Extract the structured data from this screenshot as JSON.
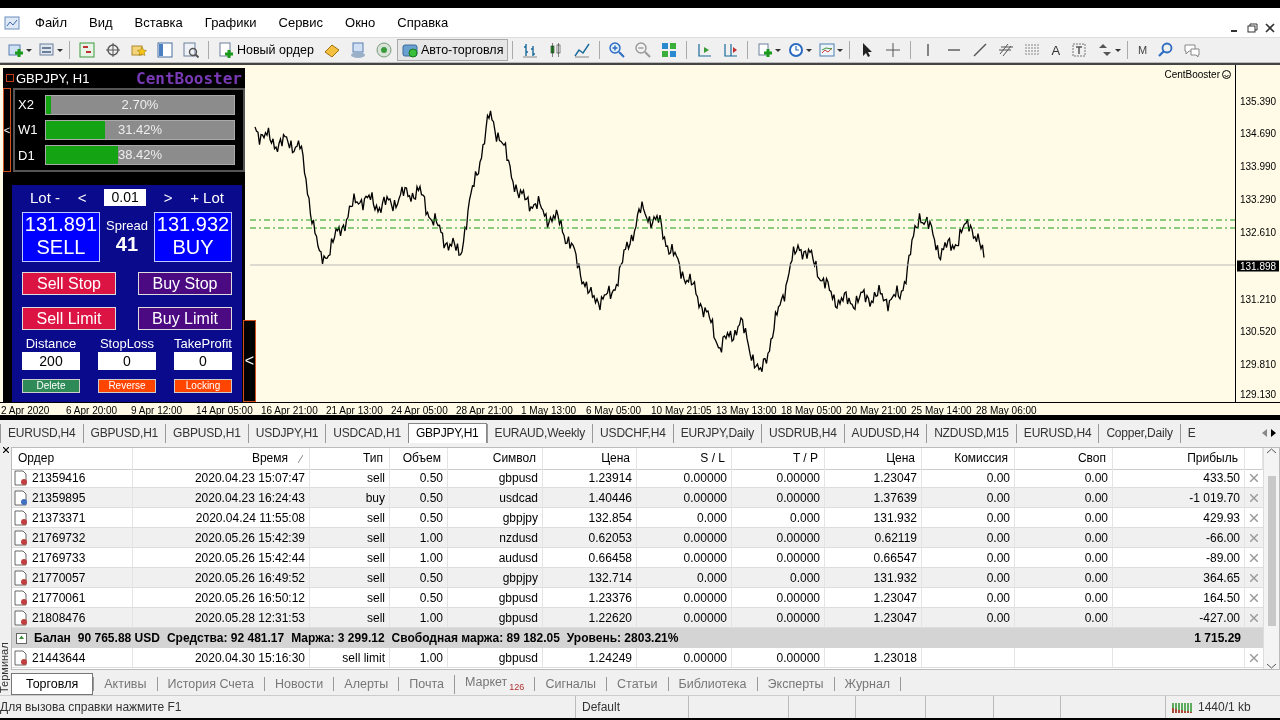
{
  "menu": [
    "Файл",
    "Вид",
    "Вставка",
    "Графики",
    "Сервис",
    "Окно",
    "Справка"
  ],
  "toolbar": {
    "new_order": "Новый ордер",
    "auto_trading": "Авто-торговля",
    "text_tool": "A",
    "m_button": "M"
  },
  "chart": {
    "indicator_label": "CentBooster",
    "price_labels": [
      "135.390",
      "134.690",
      "133.990",
      "133.290",
      "132.610",
      "131.210",
      "130.520",
      "129.810",
      "129.130"
    ],
    "current_price": "131.898",
    "time_labels": [
      "2 Apr 2020",
      "6 Apr 20:00",
      "9 Apr 12:00",
      "14 Apr 05:00",
      "16 Apr 21:00",
      "21 Apr 13:00",
      "24 Apr 05:00",
      "28 Apr 21:00",
      "1 May 13:00",
      "6 May 05:00",
      "10 May 21:05",
      "13 May 13:00",
      "18 May 05:00",
      "20 May 21:00",
      "25 May 14:00",
      "28 May 06:00"
    ]
  },
  "panel": {
    "title": "GBPJPY, H1",
    "brand": "CentBooster",
    "side_tab": "<",
    "collapse_tab": "<",
    "bars": [
      {
        "label": "X2",
        "level": 0.027,
        "reading": "2.70%"
      },
      {
        "label": "W1",
        "level": 0.3142,
        "reading": "31.42%"
      },
      {
        "label": "D1",
        "level": 0.3842,
        "reading": "38.42%"
      }
    ],
    "lot_minus": "Lot -",
    "lot_dec": "<",
    "lot": "0.01",
    "lot_inc": ">",
    "lot_plus": "+ Lot",
    "sell_price": "131.891",
    "sell": "SELL",
    "spread_label": "Spread",
    "spread": "41",
    "buy_price": "131.932",
    "buy": "BUY",
    "orders": [
      {
        "label": "Sell Stop",
        "kind": "sell"
      },
      {
        "label": "Buy Stop",
        "kind": "buy"
      },
      {
        "label": "Sell Limit",
        "kind": "sell"
      },
      {
        "label": "Buy Limit",
        "kind": "buy"
      }
    ],
    "fields": [
      {
        "label": "Distance",
        "value": "200"
      },
      {
        "label": "StopLoss",
        "value": "0"
      },
      {
        "label": "TakeProfit",
        "value": "0"
      }
    ],
    "actions": [
      {
        "label": "Delete",
        "kind": "delete"
      },
      {
        "label": "Reverse",
        "kind": "reverse"
      },
      {
        "label": "Locking",
        "kind": "locking"
      }
    ]
  },
  "symbol_tabs": [
    {
      "label": "EURUSD,H4",
      "selected": false
    },
    {
      "label": "GBPUSD,H1",
      "selected": false
    },
    {
      "label": "GBPUSD,H1",
      "selected": false
    },
    {
      "label": "USDJPY,H1",
      "selected": false
    },
    {
      "label": "USDCAD,H1",
      "selected": false
    },
    {
      "label": "GBPJPY,H1",
      "selected": true
    },
    {
      "label": "EURAUD,Weekly",
      "selected": false
    },
    {
      "label": "USDCHF,H4",
      "selected": false
    },
    {
      "label": "EURJPY,Daily",
      "selected": false
    },
    {
      "label": "USDRUB,H4",
      "selected": false
    },
    {
      "label": "AUDUSD,H4",
      "selected": false
    },
    {
      "label": "NZDUSD,M15",
      "selected": false
    },
    {
      "label": "EURUSD,H4",
      "selected": false
    },
    {
      "label": "Copper,Daily",
      "selected": false
    },
    {
      "label": "E",
      "selected": false
    }
  ],
  "terminal": {
    "side_label": "Терминал",
    "columns": [
      "Ордер",
      "Время",
      "Тип",
      "Объем",
      "Символ",
      "Цена",
      "S / L",
      "T / P",
      "Цена",
      "Комиссия",
      "Своп",
      "Прибыль"
    ],
    "rows": [
      {
        "kind": "sell",
        "cells": [
          "21359416",
          "2020.04.23 15:07:47",
          "sell",
          "0.50",
          "gbpusd",
          "1.23914",
          "0.00000",
          "0.00000",
          "1.23047",
          "0.00",
          "0.00",
          "433.50"
        ]
      },
      {
        "kind": "buy",
        "cells": [
          "21359895",
          "2020.04.23 16:24:43",
          "buy",
          "0.50",
          "usdcad",
          "1.40446",
          "0.00000",
          "0.00000",
          "1.37639",
          "0.00",
          "0.00",
          "-1 019.70"
        ]
      },
      {
        "kind": "sell",
        "cells": [
          "21373371",
          "2020.04.24 11:55:08",
          "sell",
          "0.50",
          "gbpjpy",
          "132.854",
          "0.000",
          "0.000",
          "131.932",
          "0.00",
          "0.00",
          "429.93"
        ]
      },
      {
        "kind": "sell",
        "cells": [
          "21769732",
          "2020.05.26 15:42:39",
          "sell",
          "1.00",
          "nzdusd",
          "0.62053",
          "0.00000",
          "0.00000",
          "0.62119",
          "0.00",
          "0.00",
          "-66.00"
        ]
      },
      {
        "kind": "sell",
        "cells": [
          "21769733",
          "2020.05.26 15:42:44",
          "sell",
          "1.00",
          "audusd",
          "0.66458",
          "0.00000",
          "0.00000",
          "0.66547",
          "0.00",
          "0.00",
          "-89.00"
        ]
      },
      {
        "kind": "sell",
        "cells": [
          "21770057",
          "2020.05.26 16:49:52",
          "sell",
          "0.50",
          "gbpjpy",
          "132.714",
          "0.000",
          "0.000",
          "131.932",
          "0.00",
          "0.00",
          "364.65"
        ]
      },
      {
        "kind": "sell",
        "cells": [
          "21770061",
          "2020.05.26 16:50:12",
          "sell",
          "0.50",
          "gbpusd",
          "1.23376",
          "0.00000",
          "0.00000",
          "1.23047",
          "0.00",
          "0.00",
          "164.50"
        ]
      },
      {
        "kind": "sell",
        "cells": [
          "21808476",
          "2020.05.28 12:31:53",
          "sell",
          "1.00",
          "gbpusd",
          "1.22620",
          "0.00000",
          "0.00000",
          "1.23047",
          "0.00",
          "0.00",
          "-427.00"
        ]
      }
    ],
    "balance": {
      "label": "Балан",
      "balance": "90 765.88 USD",
      "equity": "Средства: 92 481.17",
      "margin": "Маржа: 3 299.12",
      "free_margin": "Свободная маржа: 89 182.05",
      "margin_level": "Уровень: 2803.21%",
      "profit": "1 715.29"
    },
    "pending": [
      {
        "kind": "sell",
        "cells": [
          "21443644",
          "2020.04.30 15:16:30",
          "sell limit",
          "1.00",
          "gbpusd",
          "1.24249",
          "0.00000",
          "0.00000",
          "1.23018"
        ]
      }
    ],
    "tabs": [
      {
        "label": "Торговля",
        "selected": true
      },
      {
        "label": "Активы",
        "selected": false
      },
      {
        "label": "История Счета",
        "selected": false
      },
      {
        "label": "Новости",
        "selected": false
      },
      {
        "label": "Алерты",
        "selected": false
      },
      {
        "label": "Почта",
        "selected": false
      },
      {
        "label": "Маркет",
        "selected": false,
        "badge": "126"
      },
      {
        "label": "Сигналы",
        "selected": false
      },
      {
        "label": "Статьи",
        "selected": false
      },
      {
        "label": "Библиотека",
        "selected": false
      },
      {
        "label": "Эксперты",
        "selected": false
      },
      {
        "label": "Журнал",
        "selected": false
      }
    ]
  },
  "status_bar": {
    "help": "Для вызова справки нажмите F1",
    "profile": "Default",
    "traffic": "1440/1 kb"
  }
}
